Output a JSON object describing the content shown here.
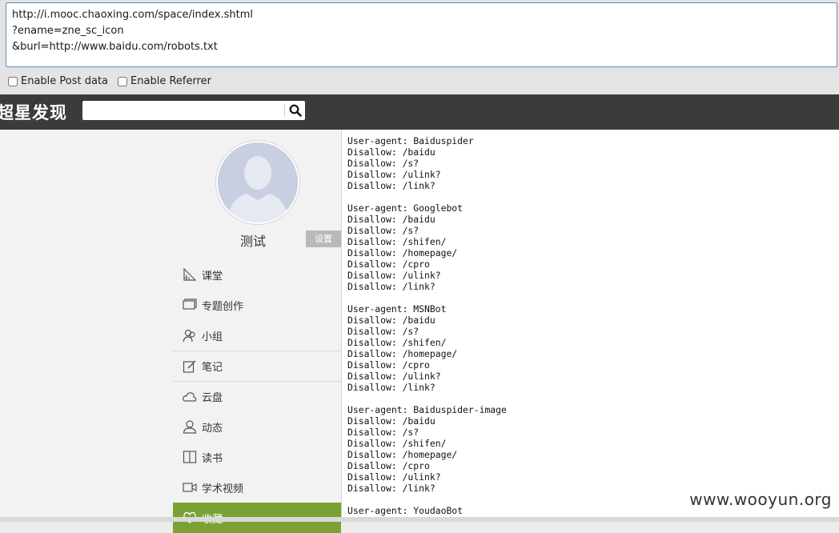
{
  "url_box": {
    "lines": [
      "http://i.mooc.chaoxing.com/space/index.shtml",
      "?ename=zne_sc_icon",
      "&burl=http://www.baidu.com/robots.txt"
    ]
  },
  "options": {
    "post_data_label": "Enable Post data",
    "referrer_label": "Enable Referrer"
  },
  "header": {
    "brand": "超星发现",
    "search_placeholder": ""
  },
  "profile": {
    "name": "测试",
    "settings_label": "设置"
  },
  "menu": [
    {
      "label": "课堂",
      "icon": "classroom-icon"
    },
    {
      "label": "专题创作",
      "icon": "topic-icon"
    },
    {
      "label": "小组",
      "icon": "group-icon"
    },
    {
      "label": "笔记",
      "icon": "note-icon"
    },
    {
      "label": "云盘",
      "icon": "cloud-icon"
    },
    {
      "label": "动态",
      "icon": "user-icon"
    },
    {
      "label": "读书",
      "icon": "book-icon"
    },
    {
      "label": "学术视频",
      "icon": "video-icon"
    },
    {
      "label": "收藏",
      "icon": "favorite-icon"
    }
  ],
  "robots_txt": "User-agent: Baiduspider\nDisallow: /baidu\nDisallow: /s?\nDisallow: /ulink?\nDisallow: /link?\n\nUser-agent: Googlebot\nDisallow: /baidu\nDisallow: /s?\nDisallow: /shifen/\nDisallow: /homepage/\nDisallow: /cpro\nDisallow: /ulink?\nDisallow: /link?\n\nUser-agent: MSNBot\nDisallow: /baidu\nDisallow: /s?\nDisallow: /shifen/\nDisallow: /homepage/\nDisallow: /cpro\nDisallow: /ulink?\nDisallow: /link?\n\nUser-agent: Baiduspider-image\nDisallow: /baidu\nDisallow: /s?\nDisallow: /shifen/\nDisallow: /homepage/\nDisallow: /cpro\nDisallow: /ulink?\nDisallow: /link?\n\nUser-agent: YoudaoBot",
  "watermark": "www.wooyun.org",
  "colors": {
    "header_bg": "#3b3b3b",
    "active_menu": "#7aa134",
    "url_border": "#5b8fbd"
  }
}
